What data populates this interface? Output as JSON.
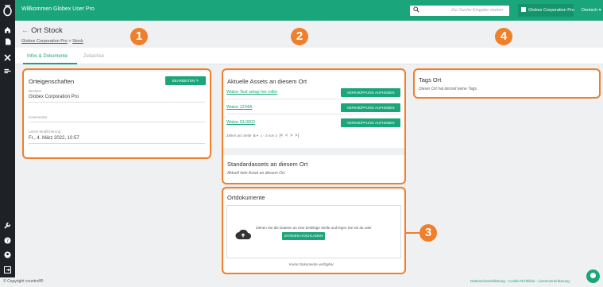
{
  "header": {
    "welcome": "Willkommen Globex User Pro",
    "search_placeholder": "Zur Suche Eingabe starten",
    "organization": "Globex Corporation Pro",
    "language": "Deutsch"
  },
  "sidebar": {
    "top_icons": [
      "home-icon",
      "document-icon",
      "asset-icon",
      "location-icon"
    ],
    "bottom_icons": [
      "wrench-icon",
      "help-icon",
      "user-icon",
      "logout-icon"
    ]
  },
  "page": {
    "title": "Ort Stock",
    "back_symbol": "←",
    "breadcrumb": [
      "Globex Corporation Pro",
      "Stock"
    ],
    "breadcrumb_sep": ">"
  },
  "tabs": [
    {
      "label": "Infos & Dokumente",
      "active": true
    },
    {
      "label": "Zeitachse",
      "active": false
    }
  ],
  "properties": {
    "title": "Orteigenschaften",
    "edit_label": "BEARBEITEN",
    "fields": [
      {
        "label": "Besitzer",
        "value": "Globex Corporation Pro"
      },
      {
        "label": "Kommentar",
        "value": ""
      },
      {
        "label": "Letzte Modifizierung",
        "value": "Fr., 4. März 2022, 10:57"
      }
    ]
  },
  "current_assets": {
    "title": "Aktuelle Assets an diesem Ort",
    "unlink_label": "VERKNÜPFUNG AUFHEBEN",
    "items": [
      "Walze Test setup hoi roller",
      "Walze 1234A",
      "Walze GL0002"
    ],
    "pager": {
      "rows_label": "Zeilen pro Seite",
      "rows_value": "5",
      "range": "1 - 3 von 3"
    }
  },
  "default_assets": {
    "title": "Standardassets an diesem Ort",
    "empty_text": "Aktuell kein Asset an diesem Ort."
  },
  "documents": {
    "title": "Ortdokumente",
    "drop_text": "Ziehen Sie die Dateien an eine beliebige Stelle und legen Sie sie ab oder",
    "upload_label": "DATEIEN HOCHLADEN",
    "empty_text": "Keine Dokumente verfügbar"
  },
  "tags": {
    "title": "Tags Ort",
    "empty_text": "Dieser Ort hat derzeit keine Tags."
  },
  "callouts": [
    "1",
    "2",
    "3",
    "4"
  ],
  "footer": {
    "copyright": "© Copyright countroll®",
    "links": "Datenschutzerklärung - Cookie-Richtlinie - Lizenzvereinbarung"
  },
  "colors": {
    "brand_green": "#1aa57a",
    "sidebar_dark": "#1e2226",
    "callout_orange": "#ef7f2a"
  }
}
